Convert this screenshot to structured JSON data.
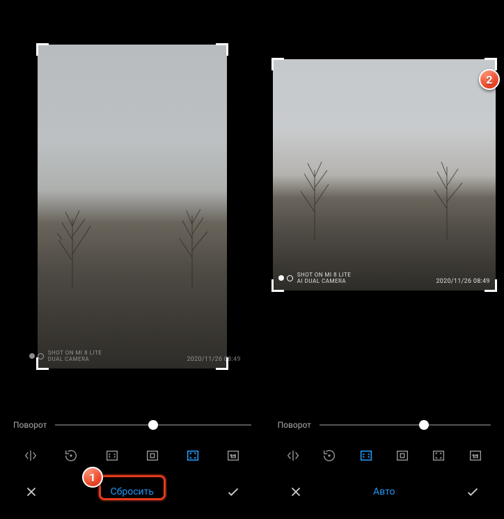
{
  "left": {
    "watermark_line1": "SHOT ON MI 8 LITE",
    "watermark_line2": "DUAL CAMERA",
    "timestamp": "2020/11/26  08:49",
    "slider_label": "Поворот",
    "slider_pos_pct": 50,
    "center_button": "Сбросить"
  },
  "right": {
    "watermark_line1": "SHOT ON MI 8 LITE",
    "watermark_line2": "AI DUAL CAMERA",
    "timestamp": "2020/11/26  08:49",
    "slider_label": "Поворот",
    "slider_pos_pct": 61,
    "center_button": "Авто"
  },
  "callouts": {
    "one": "1",
    "two": "2"
  }
}
